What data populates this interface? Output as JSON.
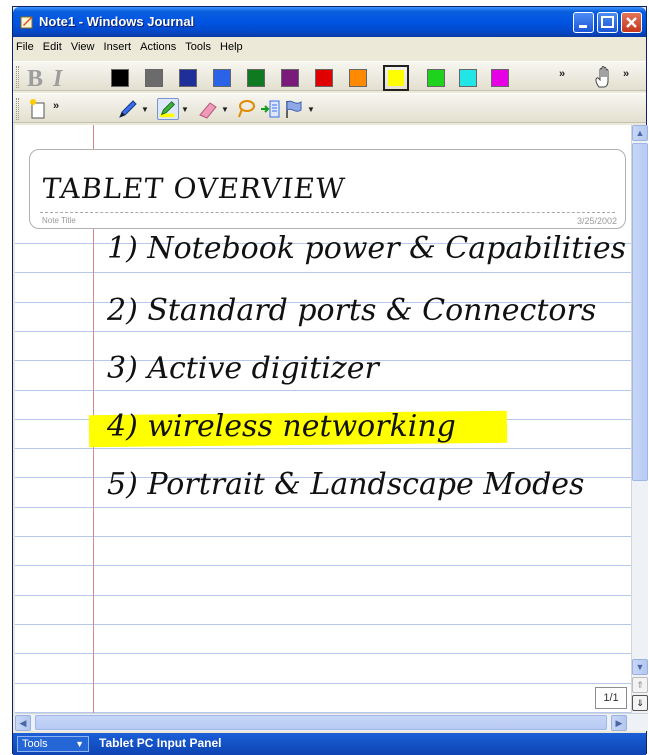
{
  "window": {
    "title": "Note1 - Windows Journal"
  },
  "menu": [
    "File",
    "Edit",
    "View",
    "Insert",
    "Actions",
    "Tools",
    "Help"
  ],
  "toolbar1": {
    "bold_label": "B",
    "italic_label": "I",
    "overflow_label": "»",
    "colors": [
      "#000000",
      "#6b6b6b",
      "#1f2f9a",
      "#2a63e8",
      "#0f7a1f",
      "#7a1a7a",
      "#e00000",
      "#ff8a00",
      "#ffff00",
      "#1ed21e",
      "#22e6e6",
      "#e600e6"
    ],
    "selected_color_index": 8
  },
  "toolbar2": {
    "overflow_label": "»"
  },
  "note": {
    "title": "TABLET OVERVIEW",
    "title_label": "Note Title",
    "date": "3/25/2002",
    "items": [
      "1) Notebook power & Capabilities",
      "2) Standard ports & Connectors",
      "3) Active digitizer",
      "4) wireless networking",
      "5) Portrait & Landscape Modes"
    ],
    "highlighted_item_index": 3,
    "highlight_color": "#ffff00"
  },
  "page_indicator": "1/1",
  "input_panel": {
    "tools_label": "Tools",
    "title": "Tablet PC Input Panel"
  }
}
